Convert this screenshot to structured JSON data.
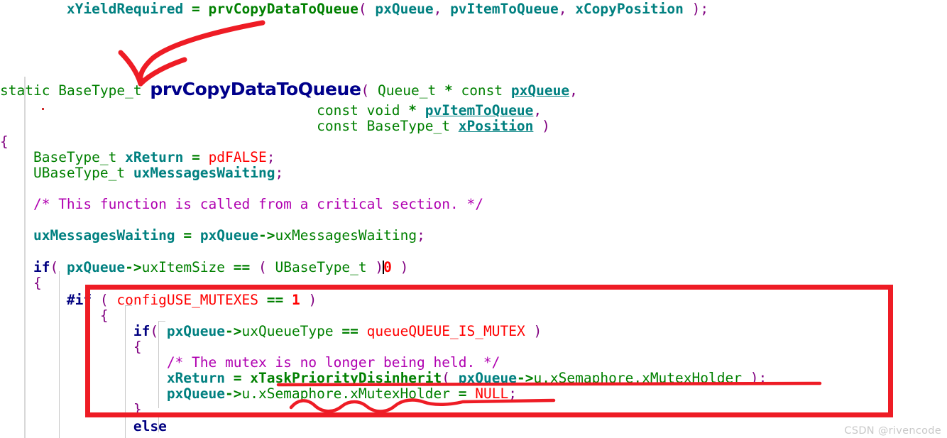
{
  "editor": {
    "language": "c",
    "watermark": "CSDN @rivencode",
    "caret_line": "if( pxQueue->uxItemSize == ( UBaseType_t ) 0 )",
    "colors": {
      "background": "#ffffff",
      "keyword": "#000080",
      "type": "#008000",
      "variable": "#008080",
      "punctuation": "#800080",
      "macro": "#ff0000",
      "comment": "#b000b0",
      "annotation_red": "#ee1c25",
      "gutter": "#d8d8d8",
      "watermark": "#c8c8c8"
    },
    "lines": [
      {
        "id": "call-site",
        "text": "        xYieldRequired = prvCopyDataToQueue( pxQueue, pvItemToQueue, xCopyPosition );"
      },
      {
        "id": "signature-1",
        "text": "static BaseType_t prvCopyDataToQueue( Queue_t * const pxQueue,"
      },
      {
        "id": "signature-2",
        "text": "                                      const void * pvItemToQueue,"
      },
      {
        "id": "signature-3",
        "text": "                                      const BaseType_t xPosition )"
      },
      {
        "id": "open-brace",
        "text": "{"
      },
      {
        "id": "decl-xreturn",
        "text": "    BaseType_t xReturn = pdFALSE;"
      },
      {
        "id": "decl-uxmsgs",
        "text": "    UBaseType_t uxMessagesWaiting;"
      },
      {
        "id": "comment-crit",
        "text": "    /* This function is called from a critical section. */"
      },
      {
        "id": "assign-uxmsgs",
        "text": "    uxMessagesWaiting = pxQueue->uxMessagesWaiting;"
      },
      {
        "id": "if-itemsize",
        "text": "    if( pxQueue->uxItemSize == ( UBaseType_t ) 0 )"
      },
      {
        "id": "brace-if",
        "text": "    {"
      },
      {
        "id": "pp-if-mutexes",
        "text": "        #if ( configUSE_MUTEXES == 1 )"
      },
      {
        "id": "brace-pp",
        "text": "        {"
      },
      {
        "id": "if-queuetype",
        "text": "            if( pxQueue->uxQueueType == queueQUEUE_IS_MUTEX )"
      },
      {
        "id": "brace-inner",
        "text": "            {"
      },
      {
        "id": "comment-mutex",
        "text": "                /* The mutex is no longer being held. */"
      },
      {
        "id": "call-disinherit",
        "text": "                xReturn = xTaskPriorityDisinherit( pxQueue->u.xSemaphore.xMutexHolder );"
      },
      {
        "id": "assign-null",
        "text": "                pxQueue->u.xSemaphore.xMutexHolder = NULL;"
      },
      {
        "id": "brace-close",
        "text": "            }"
      },
      {
        "id": "else-kw",
        "text": "            else"
      }
    ],
    "tokens": {
      "static": "static",
      "const": "const",
      "void": "void",
      "basetype": "BaseType_t",
      "ubasetype": "UBaseType_t",
      "queue_t": "Queue_t",
      "if": "if",
      "else": "else",
      "pp_if": "#if",
      "fn_def_name": "prvCopyDataToQueue",
      "fn_call_name": "prvCopyDataToQueue",
      "fn_disinherit": "xTaskPriorityDisinherit",
      "pdfalse": "pdFALSE",
      "null": "NULL",
      "config_use_mutexes": "configUSE_MUTEXES",
      "queue_is_mutex": "queueQUEUE_IS_MUTEX",
      "zero": "0",
      "one": "1"
    }
  },
  "annotations": {
    "arrow": {
      "type": "curved-arrow",
      "label": "arrow from call site to definition",
      "color": "#ee1c25"
    },
    "box": {
      "type": "rectangle",
      "label": "highlight box around configUSE_MUTEXES block",
      "color": "#ee1c25"
    },
    "underline_straight": {
      "type": "straight-underline",
      "label": "underline under xTaskPriorityDisinherit call",
      "color": "#ee1c25"
    },
    "underline_wavy": {
      "type": "wavy-underline",
      "label": "wavy underline under xMutexHolder assignment",
      "color": "#ee1c25"
    }
  }
}
